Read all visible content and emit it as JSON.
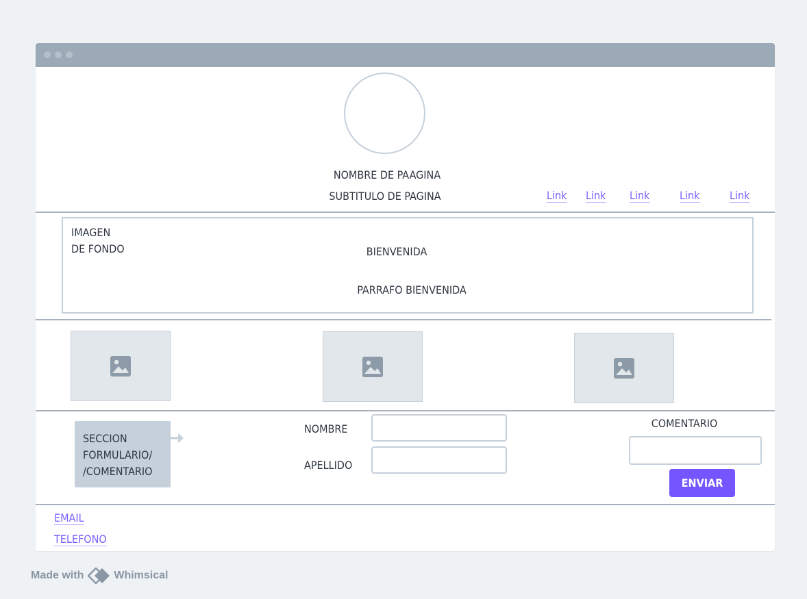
{
  "header": {
    "page_name": "NOMBRE DE PAAGINA",
    "page_subtitle": "SUBTITULO DE PAGINA",
    "nav_links": [
      "Link",
      "Link",
      "Link",
      "Link",
      "Link"
    ]
  },
  "hero": {
    "background_label_line1": "IMAGEN",
    "background_label_line2": "DE FONDO",
    "title": "BIENVENIDA",
    "paragraph": "PARRAFO BIENVENIDA"
  },
  "gallery": {
    "images": [
      "image-icon",
      "image-icon",
      "image-icon"
    ]
  },
  "form": {
    "section_note": [
      "SECCION",
      "FORMULARIO/",
      "/COMENTARIO"
    ],
    "nombre_label": "NOMBRE",
    "nombre_value": "",
    "apellido_label": "APELLIDO",
    "apellido_value": "",
    "comentario_label": "COMENTARIO",
    "comentario_value": "",
    "submit_label": "ENVIAR"
  },
  "footer": {
    "email_label": "EMAIL",
    "phone_label": "TELEFONO"
  },
  "branding": {
    "made_with": "Made with",
    "brand": "Whimsical"
  },
  "colors": {
    "accent": "#7356ff",
    "link": "#7b61ff",
    "titlebar": "#9caab7",
    "border": "#c5d0da"
  }
}
